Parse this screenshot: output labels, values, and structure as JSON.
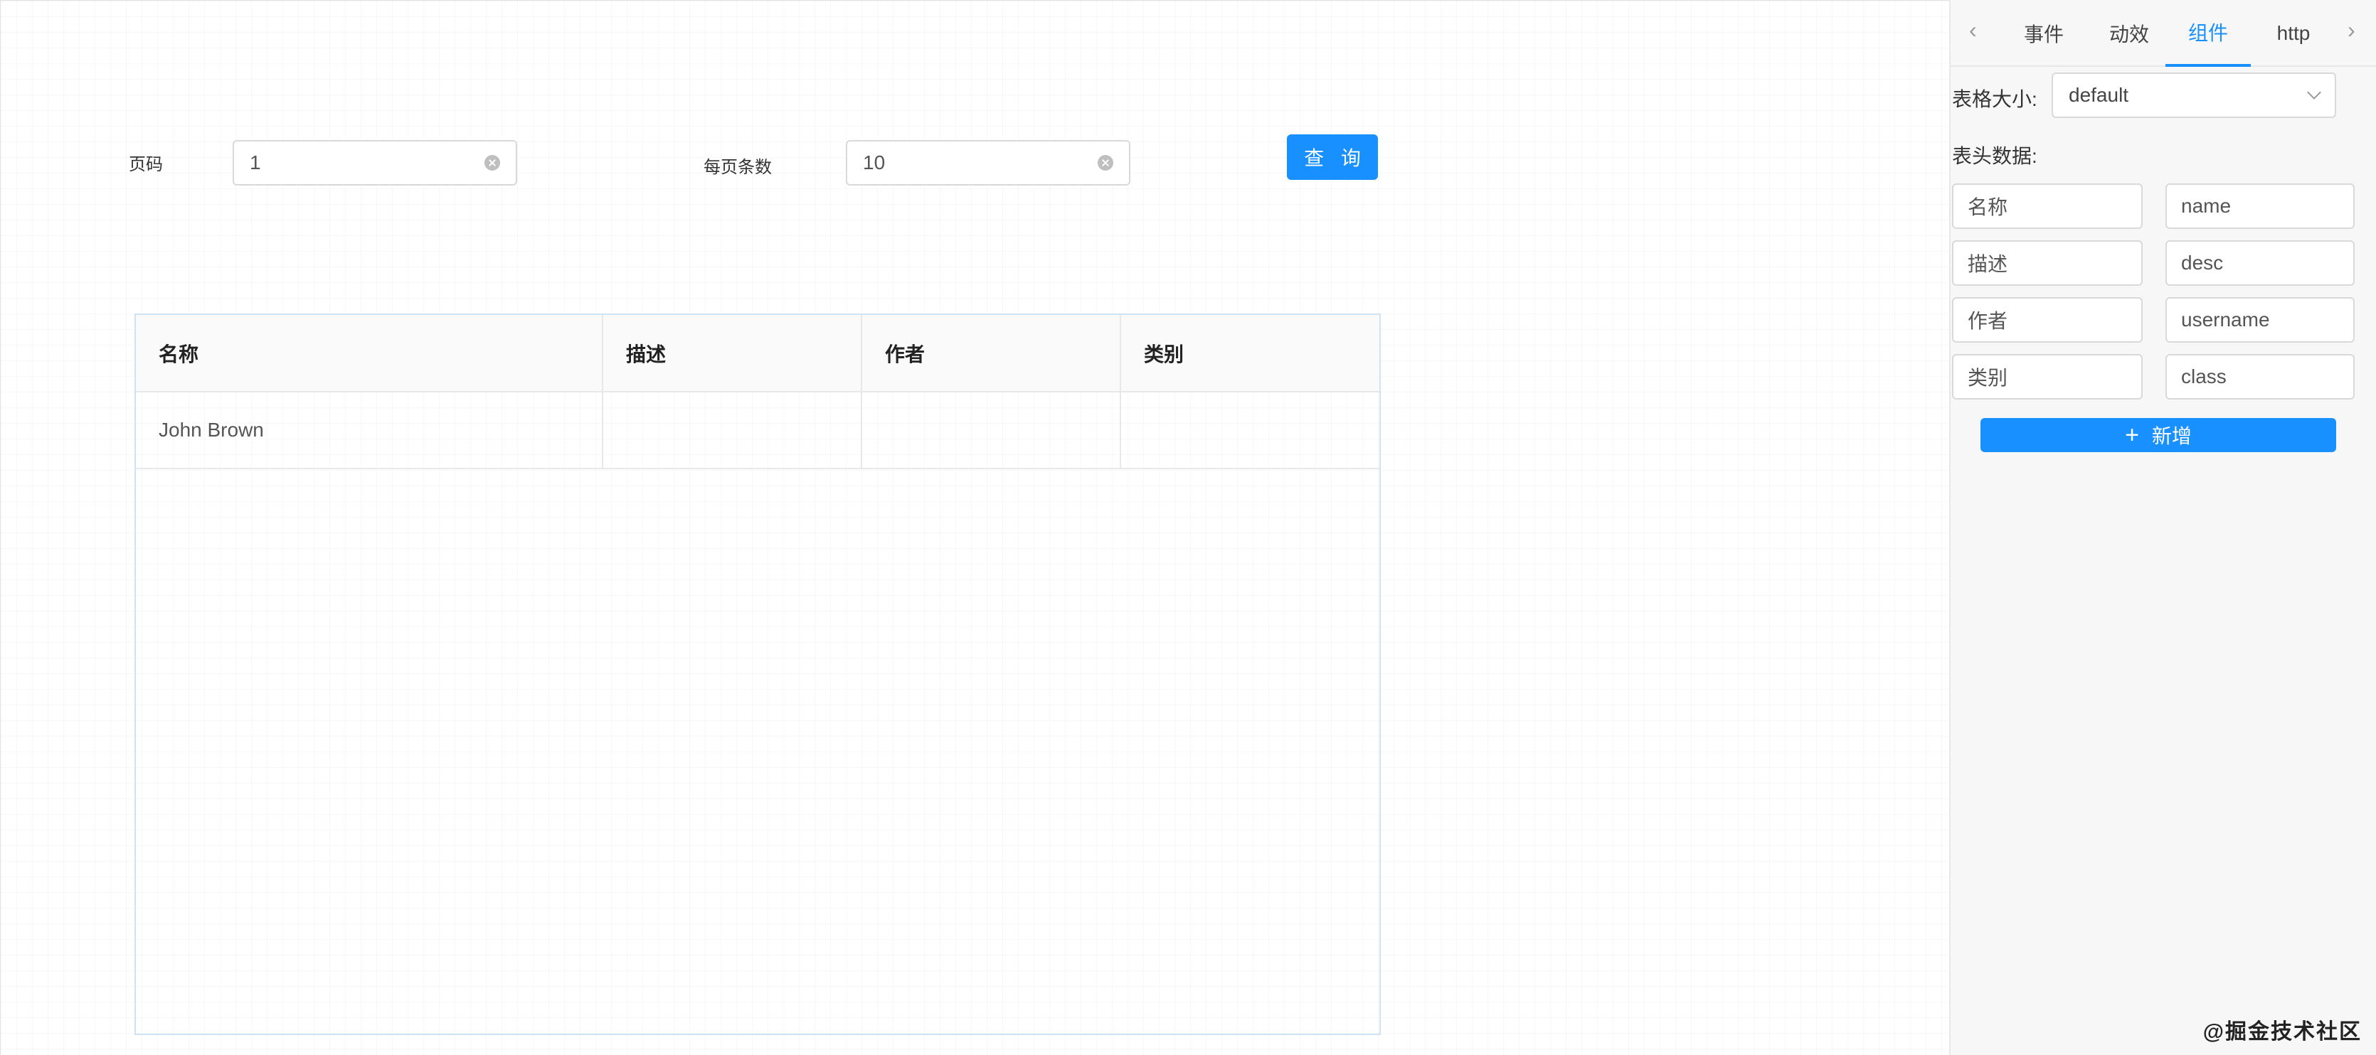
{
  "form": {
    "page_label": "页码",
    "page_value": "1",
    "page_size_label": "每页条数",
    "page_size_value": "10",
    "query_button": "查 询"
  },
  "table": {
    "columns": [
      "名称",
      "描述",
      "作者",
      "类别"
    ],
    "rows": [
      [
        "John Brown",
        "",
        "",
        ""
      ]
    ]
  },
  "panel": {
    "tabs": [
      "事件",
      "动效",
      "组件",
      "http"
    ],
    "active_tab": "组件",
    "table_size_label": "表格大小:",
    "table_size_value": "default",
    "header_data_label": "表头数据:",
    "headers": [
      {
        "title": "名称",
        "key": "name"
      },
      {
        "title": "描述",
        "key": "desc"
      },
      {
        "title": "作者",
        "key": "username"
      },
      {
        "title": "类别",
        "key": "class"
      }
    ],
    "add_button": "新增"
  },
  "watermark": "@掘金技术社区",
  "icons": {
    "clear": "close-circle-icon",
    "prev": "chevron-left-icon",
    "next": "chevron-right-icon",
    "dropdown": "chevron-down-icon",
    "add": "plus-icon"
  },
  "colors": {
    "primary": "#1890ff"
  }
}
